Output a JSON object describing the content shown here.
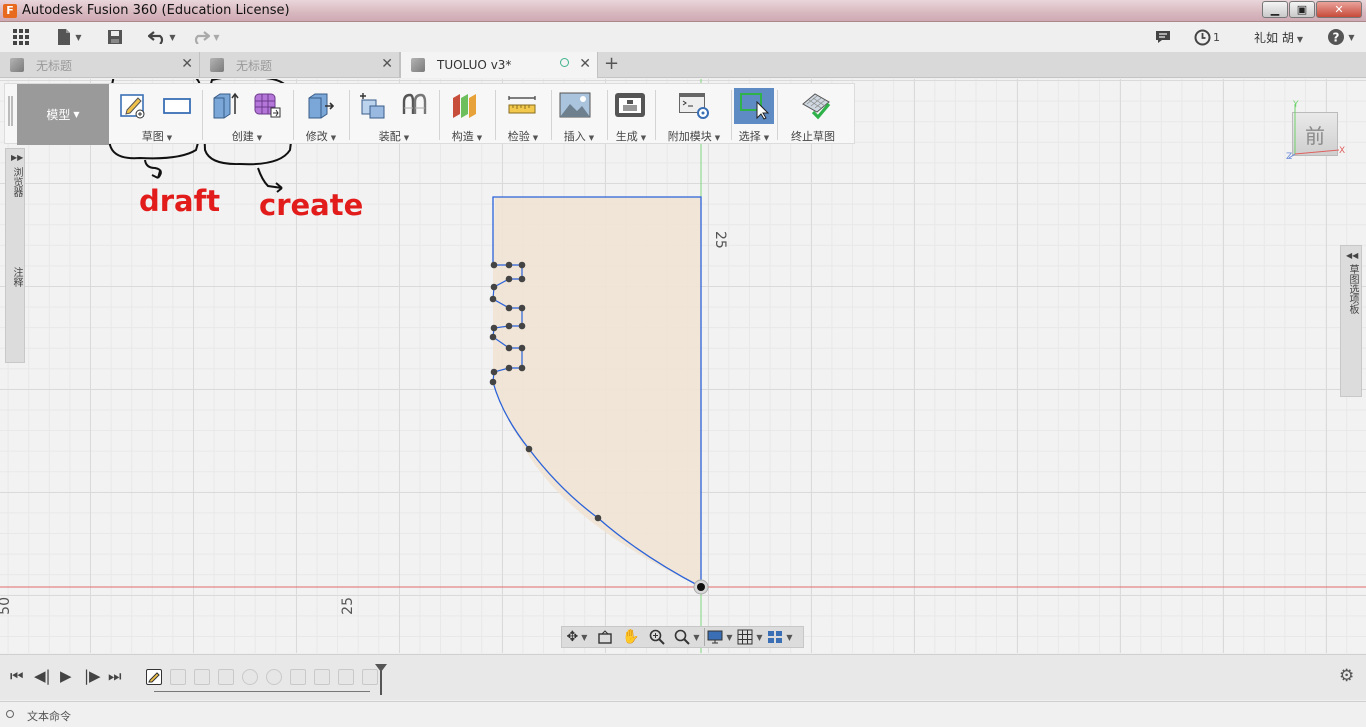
{
  "window": {
    "title": "Autodesk Fusion 360 (Education License)",
    "controls": [
      "minimize",
      "maximize",
      "close"
    ]
  },
  "appbar": {
    "icons": [
      "data-panel-icon",
      "file-icon",
      "save-icon",
      "undo-icon",
      "redo-icon"
    ],
    "job_count": "1",
    "user_name": "礼如 胡",
    "help_icon": "help-icon"
  },
  "tabs": [
    {
      "label": "无标题",
      "active": false
    },
    {
      "label": "无标题",
      "active": false
    },
    {
      "label": "TUOLUO v3*",
      "active": true
    }
  ],
  "toolbar": {
    "workspace": "模型",
    "groups": [
      {
        "id": "sketch",
        "label": "草图"
      },
      {
        "id": "create",
        "label": "创建"
      },
      {
        "id": "modify",
        "label": "修改"
      },
      {
        "id": "assemble",
        "label": "装配"
      },
      {
        "id": "construct",
        "label": "构造"
      },
      {
        "id": "inspect",
        "label": "检验"
      },
      {
        "id": "insert",
        "label": "插入"
      },
      {
        "id": "make",
        "label": "生成"
      },
      {
        "id": "addins",
        "label": "附加模块"
      },
      {
        "id": "select",
        "label": "选择"
      },
      {
        "id": "stop-sketch",
        "label": "终止草图"
      }
    ]
  },
  "browser": {
    "label": "浏览器",
    "comments_label": "注释"
  },
  "right_panel": {
    "label": "草图选项板"
  },
  "viewcube": {
    "face": "前",
    "axes": {
      "x": "X",
      "y": "Y",
      "z": "Z"
    }
  },
  "canvas": {
    "dimension_labels": {
      "vertical_25": "25",
      "horizontal_25": "25",
      "horizontal_50": "50"
    },
    "colors": {
      "profile_fill": "#f0e3d3",
      "sketch_line": "#2b62d9",
      "x_axis": "#e06060",
      "y_axis": "#6fd36f"
    }
  },
  "annotations": {
    "draft": "draft",
    "create": "create"
  },
  "timeline": {
    "controls": [
      "first",
      "previous",
      "play",
      "next",
      "last"
    ],
    "feature_count": 10
  },
  "command_line": {
    "placeholder": "文本命令"
  }
}
